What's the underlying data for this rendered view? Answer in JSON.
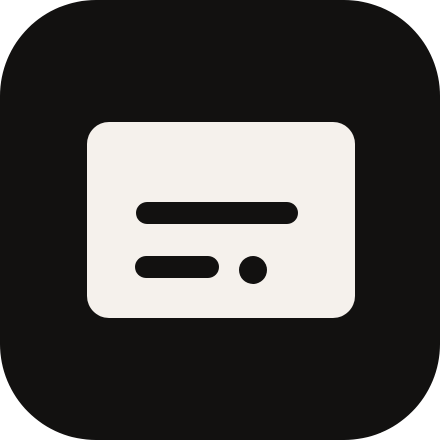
{
  "app_icon": {
    "icon_name": "card-list-icon",
    "tile_color": "#121110",
    "card_color": "#f5f1ec",
    "glyph_color": "#121110"
  }
}
